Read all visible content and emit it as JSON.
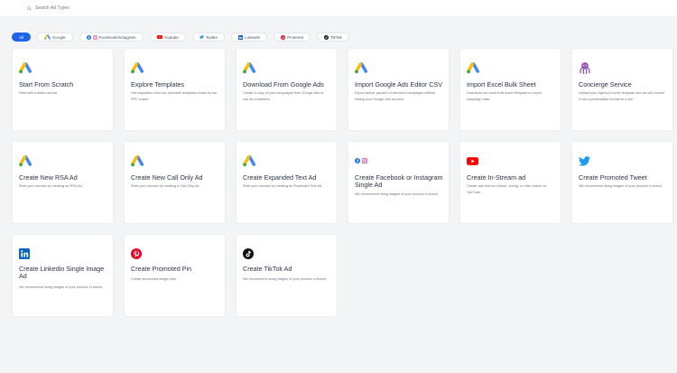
{
  "search": {
    "placeholder": "Search Ad Types"
  },
  "filters": [
    {
      "label": "All",
      "icon": "none",
      "active": true
    },
    {
      "label": "Google",
      "icon": "google-ads-icon"
    },
    {
      "label": "Facebook/Instagram",
      "icon": "facebook-instagram-icon"
    },
    {
      "label": "Youtube",
      "icon": "youtube-icon"
    },
    {
      "label": "Twitter",
      "icon": "twitter-icon"
    },
    {
      "label": "LinkedIn",
      "icon": "linkedin-icon"
    },
    {
      "label": "Pinterest",
      "icon": "pinterest-icon"
    },
    {
      "label": "TikTok",
      "icon": "tiktok-icon"
    }
  ],
  "cards": [
    {
      "title": "Start From Scratch",
      "desc": "Start with a blank canvas.",
      "icon": "google-ads-icon"
    },
    {
      "title": "Explore Templates",
      "desc": "Get inspiration from our premade templates made by our PPC expert.",
      "icon": "google-ads-icon"
    },
    {
      "title": "Download From Google Ads",
      "desc": "Create a copy of your campaigns from Google Ads to use as a baseline.",
      "icon": "google-ads-icon"
    },
    {
      "title": "Import Google Ads Editor CSV",
      "desc": "Export active, paused or removed campaigns without linking your Google Ads account.",
      "icon": "google-ads-icon"
    },
    {
      "title": "Import Excel Bulk Sheet",
      "desc": "Download our excel bulk sheet template to import campaign data.",
      "icon": "google-ads-icon"
    },
    {
      "title": "Concierge Service",
      "desc": "Upload your Agency's excel template and we will convert it into a presentable format for a fee.",
      "icon": "octopus-icon"
    },
    {
      "title": "Create New RSA Ad",
      "desc": "Start your preview by creating an RSA Ad.",
      "icon": "google-ads-icon"
    },
    {
      "title": "Create New Call Only Ad",
      "desc": "Start your preview by creating a Call Only Ad.",
      "icon": "google-ads-icon"
    },
    {
      "title": "Create Expanded Text Ad",
      "desc": "Start your preview by creating an Expanded Text Ad.",
      "icon": "google-ads-icon"
    },
    {
      "title": "Create Facebook or Instagram Single Ad",
      "desc": "We recommend using images of your product or brand.",
      "icon": "facebook-instagram-icon"
    },
    {
      "title": "Create In-Stream ad",
      "desc": "Create ads that run before, during, or after videos on YouTube.",
      "icon": "youtube-icon"
    },
    {
      "title": "Create Promoted Tweet",
      "desc": "We recommend using images of your product or brand.",
      "icon": "twitter-icon"
    },
    {
      "title": "Create Linkedin Single Image Ad",
      "desc": "We recommend using images of your product or brand.",
      "icon": "linkedin-icon"
    },
    {
      "title": "Create Promoted Pin",
      "desc": "Create sponsored image pins.",
      "icon": "pinterest-icon"
    },
    {
      "title": "Create TikTok Ad",
      "desc": "We recommend using images of your product or brand.",
      "icon": "tiktok-icon"
    }
  ],
  "colors": {
    "accent": "#1e63e9",
    "google_blue": "#4285f4",
    "google_yellow": "#fbbc04",
    "google_green": "#34a853",
    "facebook": "#1877f2",
    "youtube": "#ff0000",
    "twitter": "#1d9bf0",
    "linkedin": "#0a66c2",
    "pinterest": "#e60023",
    "octopus": "#9b59b6"
  }
}
